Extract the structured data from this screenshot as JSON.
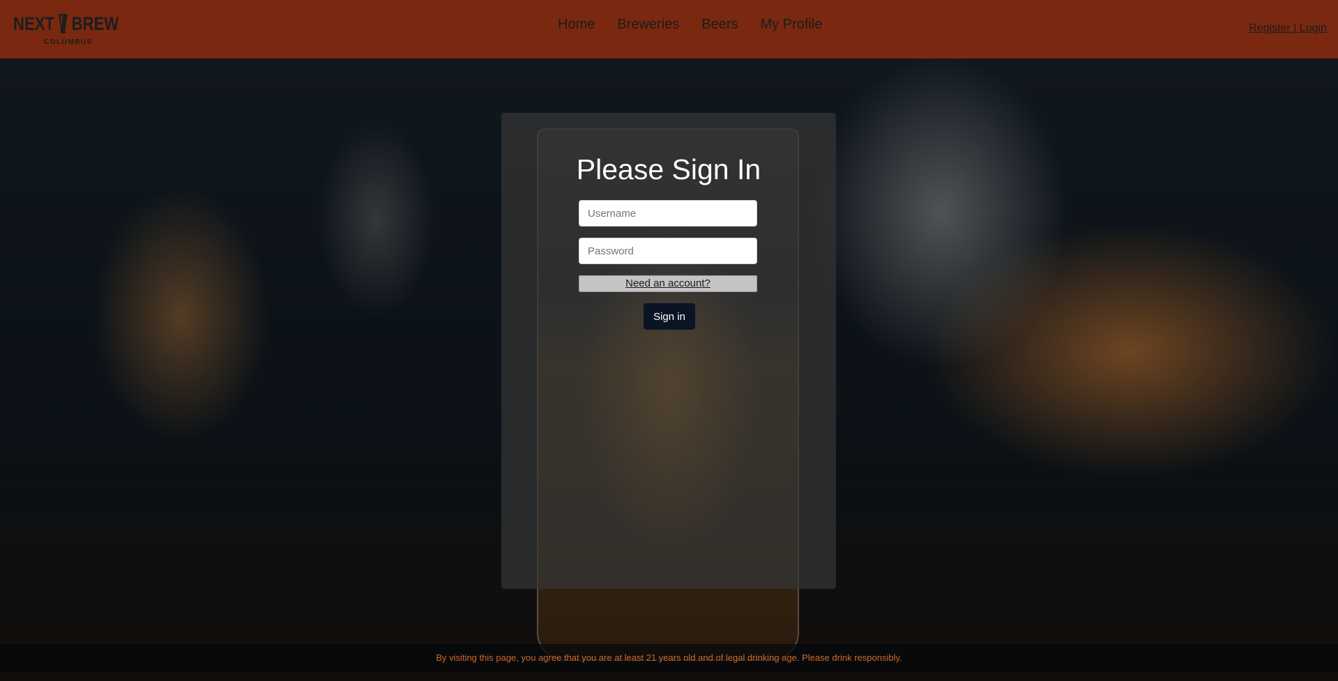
{
  "brand": {
    "logo_word_left": "NEXT",
    "logo_word_right": "BREW",
    "logo_subtitle": "COLUMBUS",
    "logo_icon": "beer-glass-icon"
  },
  "nav": {
    "items": [
      {
        "label": "Home"
      },
      {
        "label": "Breweries"
      },
      {
        "label": "Beers"
      },
      {
        "label": "My Profile"
      }
    ]
  },
  "auth": {
    "link_label": "Register | Login"
  },
  "signin": {
    "title": "Please Sign In",
    "username_placeholder": "Username",
    "username_value": "",
    "password_placeholder": "Password",
    "password_value": "",
    "need_account_label": "Need an account?",
    "submit_label": "Sign in"
  },
  "footer": {
    "notice": "By visiting this page, you agree that you are at least 21 years old and of legal drinking age. Please drink responsibly."
  },
  "colors": {
    "header_bg": "#7a2810",
    "panel_bg": "#343434",
    "button_bg": "#0b1424",
    "footer_text": "#d06a2a"
  }
}
